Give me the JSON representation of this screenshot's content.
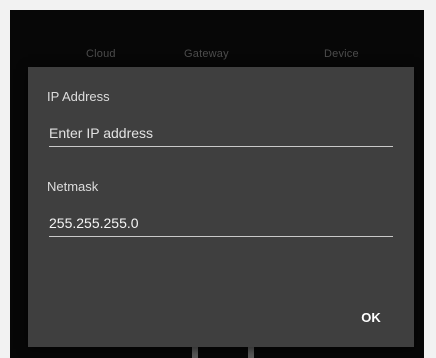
{
  "tabs": {
    "cloud": "Cloud",
    "gateway": "Gateway",
    "device": "Device"
  },
  "dialog": {
    "ip_label": "IP Address",
    "ip_placeholder": "Enter IP address",
    "ip_value": "",
    "netmask_label": "Netmask",
    "netmask_value": "255.255.255.0",
    "ok_label": "OK"
  },
  "colors": {
    "dialog_background": "#3f3f3f",
    "screen_background": "#070707",
    "inactive_tab_text": "#4c4c4c",
    "field_underline": "#c9c9c9"
  }
}
